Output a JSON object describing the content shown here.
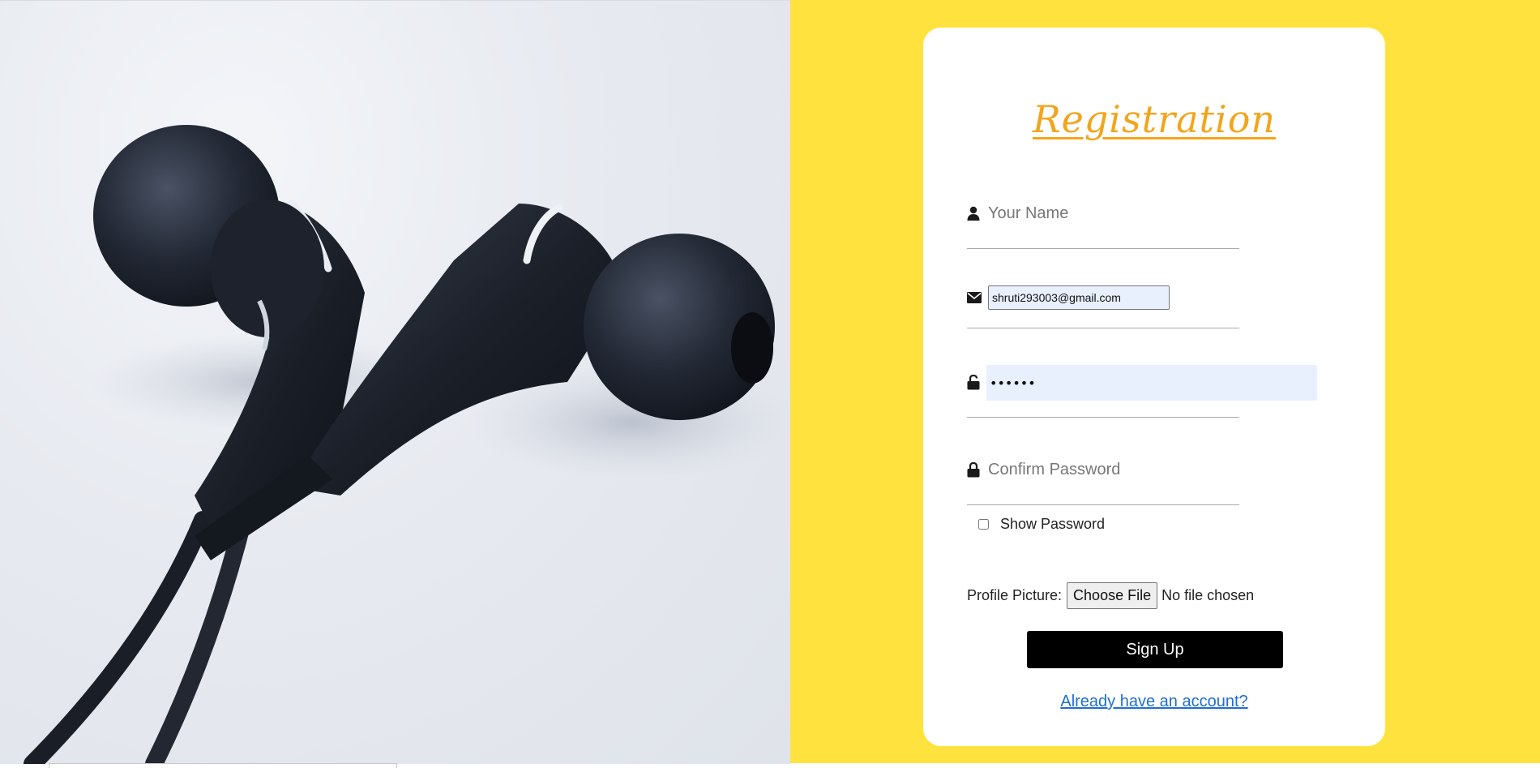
{
  "image": {
    "alt": "",
    "subject": "earphones-photo"
  },
  "form": {
    "title": "Registration",
    "name": {
      "placeholder": "Your Name",
      "value": "",
      "icon": "user-icon"
    },
    "email": {
      "placeholder": "",
      "value": "shruti293003@gmail.com",
      "icon": "envelope-icon"
    },
    "password": {
      "placeholder": "",
      "value": "••••••",
      "icon": "unlock-icon"
    },
    "confirm_password": {
      "placeholder": "Confirm Password",
      "value": "",
      "icon": "lock-icon"
    },
    "show_password_label": "Show Password",
    "show_password_checked": false,
    "profile_picture_label": "Profile Picture:",
    "choose_file_label": "Choose File",
    "no_file_text": "No file chosen",
    "submit_label": "Sign Up",
    "login_link_text": "Already have an account?"
  },
  "colors": {
    "accent": "#f2a51c",
    "panel_background": "#ffe23d",
    "autofill_background": "#e8f0fe",
    "link": "#1e6fd1",
    "button": "#000000"
  }
}
